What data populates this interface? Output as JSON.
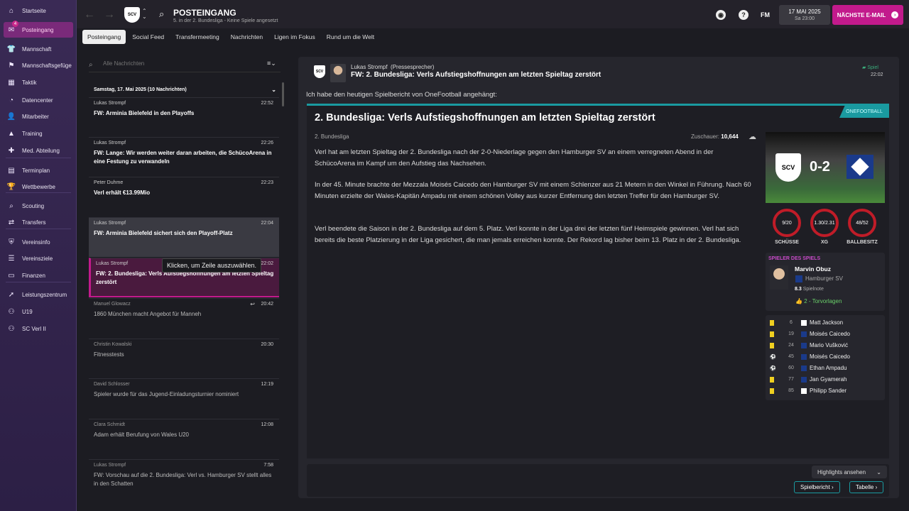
{
  "sidebar": {
    "items": [
      {
        "label": "Startseite",
        "icon": "home-icon"
      },
      {
        "label": "Posteingang",
        "icon": "inbox-icon",
        "badge": "4"
      },
      {
        "label": "Mannschaft",
        "icon": "squad-icon"
      },
      {
        "label": "Mannschaftsgefüge",
        "icon": "dynamics-icon"
      },
      {
        "label": "Taktik",
        "icon": "tactics-icon"
      },
      {
        "label": "Datencenter",
        "icon": "data-icon"
      },
      {
        "label": "Mitarbeiter",
        "icon": "staff-icon"
      },
      {
        "label": "Training",
        "icon": "training-icon"
      },
      {
        "label": "Med. Abteilung",
        "icon": "medical-icon"
      },
      {
        "label": "Terminplan",
        "icon": "calendar-icon"
      },
      {
        "label": "Wettbewerbe",
        "icon": "trophy-icon"
      },
      {
        "label": "Scouting",
        "icon": "scouting-icon"
      },
      {
        "label": "Transfers",
        "icon": "transfers-icon"
      },
      {
        "label": "Vereinsinfo",
        "icon": "club-info-icon"
      },
      {
        "label": "Vereinsziele",
        "icon": "club-goals-icon"
      },
      {
        "label": "Finanzen",
        "icon": "finances-icon"
      },
      {
        "label": "Leistungszentrum",
        "icon": "development-icon"
      },
      {
        "label": "U19",
        "icon": "u19-icon"
      },
      {
        "label": "SC Verl II",
        "icon": "reserve-icon"
      }
    ]
  },
  "header": {
    "title": "POSTEINGANG",
    "subtitle": "5. in der 2. Bundesliga - Keine Spiele angesetzt",
    "fm_label": "FM",
    "date": "17 MAI 2025",
    "time": "Sa 23:00",
    "next_button": "NÄCHSTE E-MAIL"
  },
  "tabs": [
    "Posteingang",
    "Social Feed",
    "Transfermeeting",
    "Nachrichten",
    "Ligen im Fokus",
    "Rund um die Welt"
  ],
  "list": {
    "search_placeholder": "Alle Nachrichten",
    "group_header": "Samstag, 17. Mai 2025 (10 Nachrichten)",
    "tooltip": "Klicken, um Zeile auszuwählen.",
    "messages": [
      {
        "sender": "Lukas Strompf",
        "time": "22:52",
        "subject": "FW: Arminia Bielefeld in den Playoffs"
      },
      {
        "sender": "Lukas Strompf",
        "time": "22:26",
        "subject": "FW: Lange: Wir werden weiter daran arbeiten, die SchücoArena in eine Festung zu verwandeln"
      },
      {
        "sender": "Peter Duhme",
        "time": "22:23",
        "subject": "Verl erhält €13.99Mio"
      },
      {
        "sender": "Lukas Strompf",
        "time": "22:04",
        "subject": "FW: Arminia Bielefeld sichert sich den Playoff-Platz"
      },
      {
        "sender": "Lukas Strompf",
        "time": "22:02",
        "subject": "FW: 2. Bundesliga: Verls Aufstiegshoffnungen am letzten Spieltag zerstört"
      },
      {
        "sender": "Manuel Glowacz",
        "time": "20:42",
        "subject": "1860 München macht Angebot für Manneh"
      },
      {
        "sender": "Christin Kowalski",
        "time": "20:30",
        "subject": "Fitnesstests"
      },
      {
        "sender": "David Schlosser",
        "time": "12:19",
        "subject": "Spieler wurde für das Jugend-Einladungsturnier nominiert"
      },
      {
        "sender": "Clara Schmidt",
        "time": "12:08",
        "subject": "Adam erhält Berufung von Wales U20"
      },
      {
        "sender": "Lukas Strompf",
        "time": "7:58",
        "subject": "FW: Vorschau auf die 2. Bundesliga: Verl vs. Hamburger SV stellt alles in den Schatten"
      }
    ]
  },
  "detail": {
    "sender": "Lukas Strompf",
    "role": "(Pressesprecher)",
    "subject": "FW: 2. Bundesliga: Verls Aufstiegshoffnungen am letzten Spieltag zerstört",
    "tag": "Spiel",
    "time": "22:02",
    "intro": "Ich habe den heutigen Spielbericht von OneFootball angehängt:",
    "article": {
      "source": "ONEFOOTBALL",
      "headline": "2. Bundesliga: Verls Aufstiegshoffnungen am letzten Spieltag zerstört",
      "league": "2. Bundesliga",
      "attendance_label": "Zuschauer:",
      "attendance": "10,644",
      "p1": "Verl hat am letzten Spieltag der 2. Bundesliga nach der 2-0-Niederlage gegen den Hamburger SV an einem verregneten Abend in der SchücoArena im Kampf um den Aufstieg das Nachsehen.",
      "p2": "In der 45. Minute brachte der Mezzala Moisés Caicedo den Hamburger SV mit einem Schlenzer aus 21 Metern in den Winkel in Führung. Nach 60 Minuten erzielte der Wales-Kapitän Ampadu mit einem schönen Volley aus kurzer Entfernung den letzten Treffer für den Hamburger SV.",
      "p3": "Verl beendete die Saison in der 2. Bundesliga auf dem 5. Platz. Verl konnte in der Liga drei der letzten fünf Heimspiele gewinnen. Verl hat sich bereits die beste Platzierung in der Liga gesichert, die man jemals erreichen konnte. Der Rekord lag bisher beim 13. Platz in der 2. Bundesliga."
    },
    "score": "0-2",
    "home_badge": "SCV",
    "stats": [
      {
        "value": "9/20",
        "label": "SCHÜSSE"
      },
      {
        "value": "1.30/2.31",
        "label": "XG"
      },
      {
        "value": "48/52",
        "label": "BALLBESITZ"
      }
    ],
    "potm": {
      "header": "SPIELER DES SPIELS",
      "name": "Marvin Obuz",
      "club": "Hamburger SV",
      "rating": "8.3",
      "rating_label": "Spielnote",
      "assists": "2 - Torvorlagen"
    },
    "events": [
      {
        "minute": "6",
        "player": "Matt Jackson",
        "type": "yellow"
      },
      {
        "minute": "19",
        "player": "Moisés Caicedo",
        "type": "yellow"
      },
      {
        "minute": "24",
        "player": "Mario Vušković",
        "type": "yellow"
      },
      {
        "minute": "45",
        "player": "Moisés Caicedo",
        "type": "goal"
      },
      {
        "minute": "60",
        "player": "Ethan Ampadu",
        "type": "goal"
      },
      {
        "minute": "77",
        "player": "Jan Gyamerah",
        "type": "yellow"
      },
      {
        "minute": "85",
        "player": "Philipp Sander",
        "type": "yellow"
      }
    ],
    "highlights": "Highlights ansehen",
    "report_btn": "Spielbericht",
    "table_btn": "Tabelle"
  },
  "colors": {
    "accent": "#c21a8c",
    "teal": "#1a9aa0",
    "card_red": "#c01c28"
  }
}
